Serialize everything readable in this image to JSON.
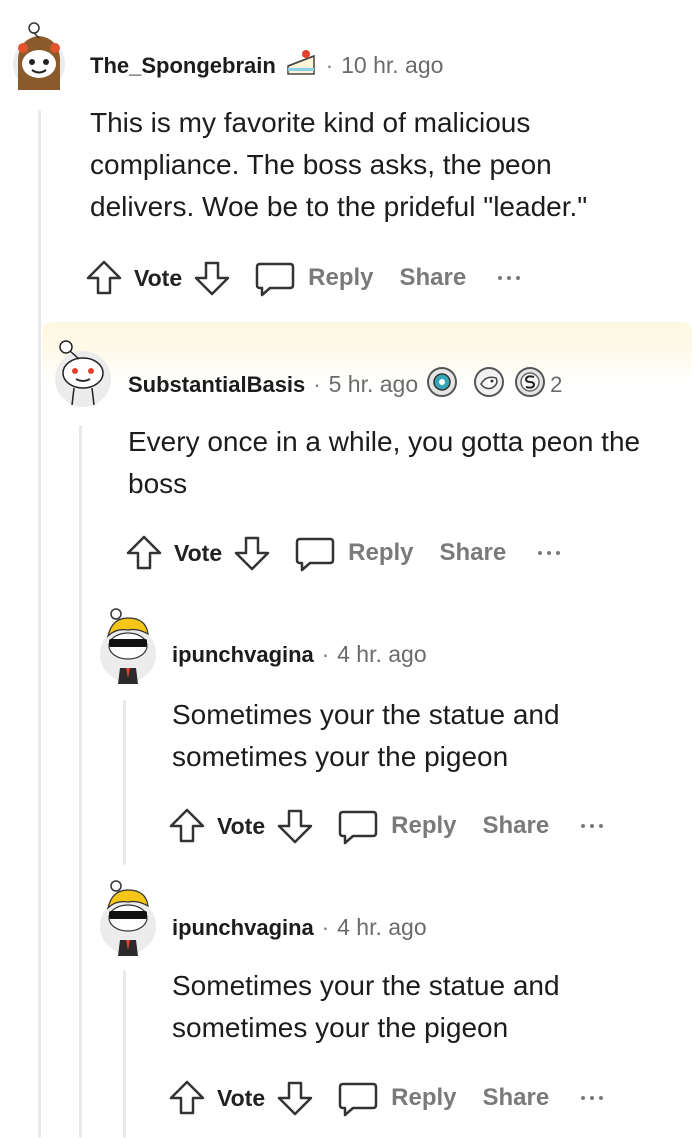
{
  "comments": [
    {
      "username": "The_Spongebrain",
      "dot": "·",
      "time": "10 hr. ago",
      "lines": [
        "This is my favorite kind of malicious",
        "compliance. The boss asks, the peon",
        "delivers. Woe be to the prideful \"leader.\""
      ],
      "actions": {
        "vote": "Vote",
        "reply": "Reply",
        "share": "Share"
      }
    },
    {
      "username": "SubstantialBasis",
      "dot": "·",
      "time": "5 hr. ago",
      "award_count": "2",
      "lines": [
        "Every once in a while, you gotta peon the",
        "boss"
      ],
      "actions": {
        "vote": "Vote",
        "reply": "Reply",
        "share": "Share"
      }
    },
    {
      "username": "ipunchvagina",
      "dot": "·",
      "time": "4 hr. ago",
      "lines": [
        "Sometimes your the statue and",
        "sometimes your the pigeon"
      ],
      "actions": {
        "vote": "Vote",
        "reply": "Reply",
        "share": "Share"
      }
    },
    {
      "username": "ipunchvagina",
      "dot": "·",
      "time": "4 hr. ago",
      "lines": [
        "Sometimes your the statue and",
        "sometimes your the pigeon"
      ],
      "actions": {
        "vote": "Vote",
        "reply": "Reply",
        "share": "Share"
      }
    }
  ]
}
